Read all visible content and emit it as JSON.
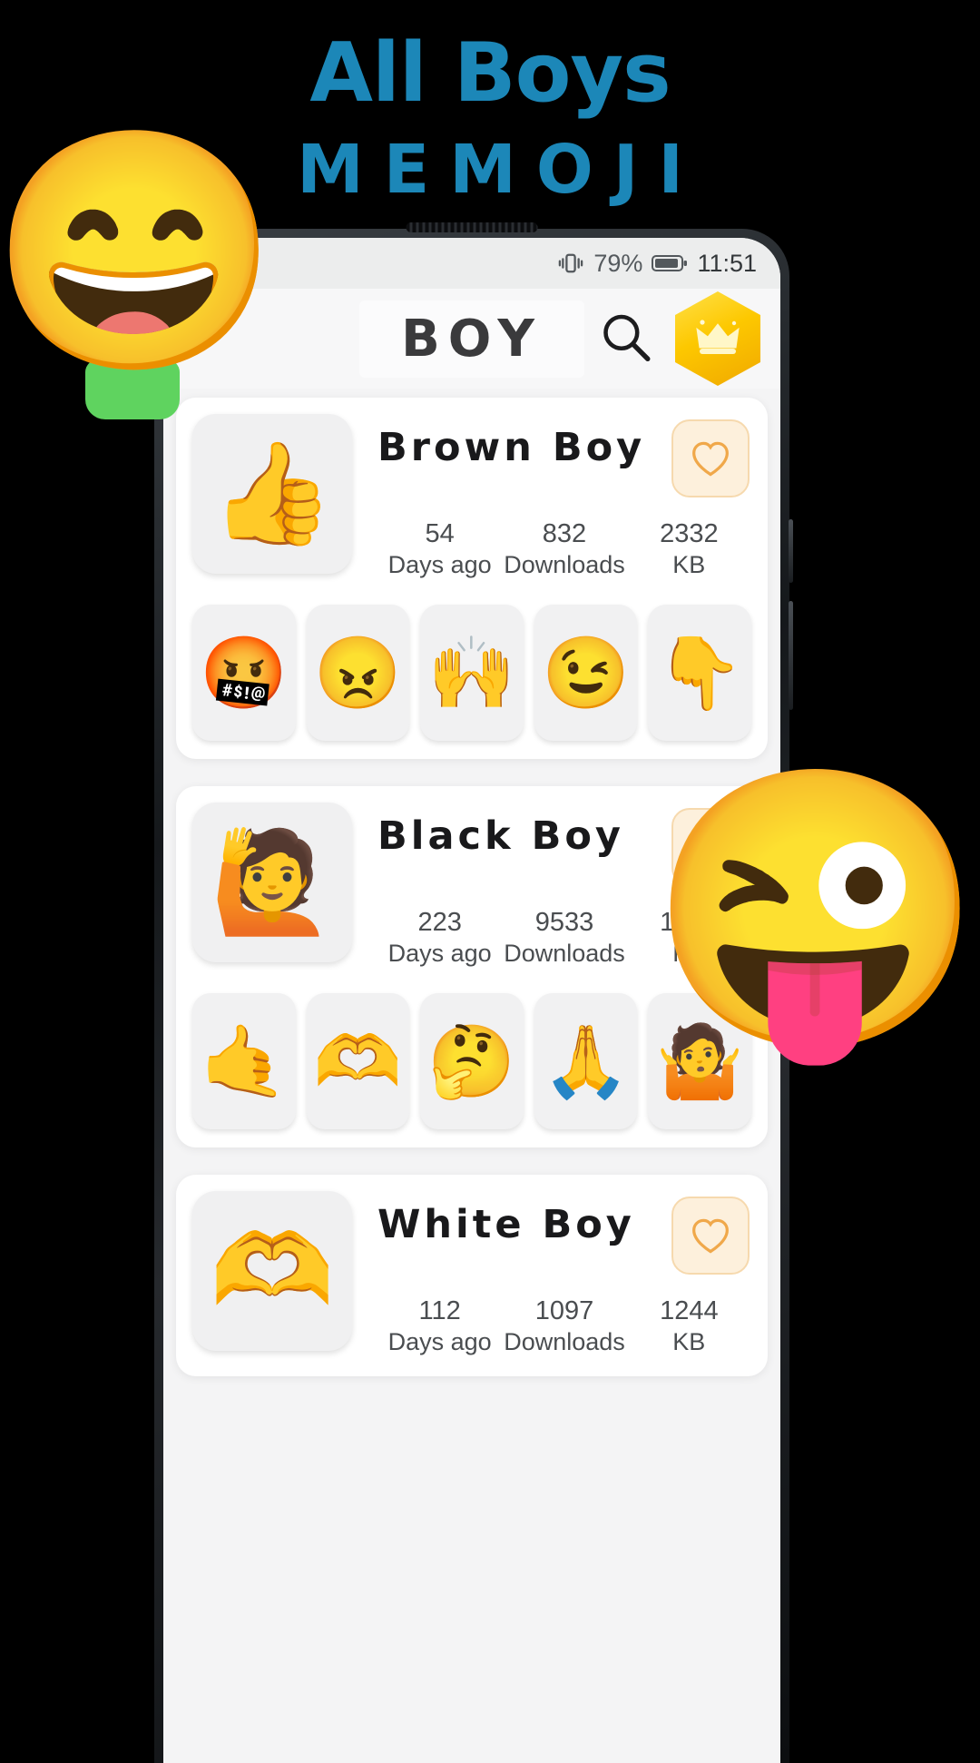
{
  "promo": {
    "title": "All Boys",
    "subtitle": "MEMOJI",
    "accent_color": "#1c87b8"
  },
  "statusbar": {
    "wifi_icon": "wifi-icon",
    "alarm_icon": "alarm-icon",
    "vibrate_icon": "vibrate-icon",
    "battery_percent": "79%",
    "battery_icon": "battery-icon",
    "time": "11:51"
  },
  "appbar": {
    "title": "BOY",
    "search_icon": "search-icon",
    "premium_icon": "crown-icon",
    "premium_color": "#fdc800"
  },
  "cards": [
    {
      "name": "Brown Boy",
      "hero_emoji": "👍",
      "favorite_icon": "heart-icon",
      "favorited": false,
      "stats": [
        {
          "value": "54",
          "label": "Days ago"
        },
        {
          "value": "832",
          "label": "Downloads"
        },
        {
          "value": "2332",
          "label": "KB"
        }
      ],
      "thumbs": [
        "🤬",
        "😠",
        "🙌",
        "😉",
        "👇"
      ]
    },
    {
      "name": "Black Boy",
      "hero_emoji": "🙋",
      "favorite_icon": "heart-icon",
      "favorited": false,
      "stats": [
        {
          "value": "223",
          "label": "Days ago"
        },
        {
          "value": "9533",
          "label": "Downloads"
        },
        {
          "value": "1234",
          "label": "KB"
        }
      ],
      "thumbs": [
        "🤙",
        "🫶",
        "🤔",
        "🙏",
        "🤷"
      ]
    },
    {
      "name": "White Boy",
      "hero_emoji": "🫶",
      "favorite_icon": "heart-icon",
      "favorited": false,
      "stats": [
        {
          "value": "112",
          "label": "Days ago"
        },
        {
          "value": "1097",
          "label": "Downloads"
        },
        {
          "value": "1244",
          "label": "KB"
        }
      ],
      "thumbs": []
    }
  ],
  "decorations": {
    "left_memoji": "😄",
    "right_memoji": "😜"
  }
}
